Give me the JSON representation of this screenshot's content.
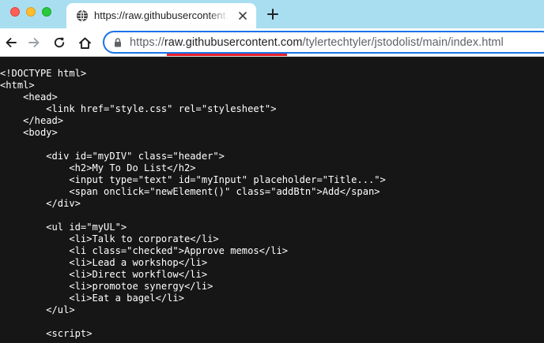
{
  "browser": {
    "tab_title": "https://raw.githubusercontent.com/tylertechtyler/jstodolist/main/index.html",
    "address_bar": {
      "scheme": "https://",
      "host": "raw.githubusercontent.com",
      "path": "/tylertechtyler/jstodolist/main/index.html"
    }
  },
  "document": {
    "lines": [
      "<!DOCTYPE html>",
      "<html>",
      "    <head>",
      "        <link href=\"style.css\" rel=\"stylesheet\">",
      "    </head>",
      "    <body>",
      "",
      "        <div id=\"myDIV\" class=\"header\">",
      "            <h2>My To Do List</h2>",
      "            <input type=\"text\" id=\"myInput\" placeholder=\"Title...\">",
      "            <span onclick=\"newElement()\" class=\"addBtn\">Add</span>",
      "        </div>",
      "",
      "        <ul id=\"myUL\">",
      "            <li>Talk to corporate</li>",
      "            <li class=\"checked\">Approve memos</li>",
      "            <li>Lead a workshop</li>",
      "            <li>Direct workflow</li>",
      "            <li>promotoe synergy</li>",
      "            <li>Eat a bagel</li>",
      "        </ul>",
      "",
      "        <script>"
    ]
  },
  "colors": {
    "tabbar_bg": "#a9def0",
    "omnibox_focus": "#1a73e8",
    "annotation_underline": "#e8202a",
    "page_bg": "#161616"
  },
  "icons": [
    "globe-icon",
    "close-icon",
    "plus-icon",
    "back-arrow-icon",
    "forward-arrow-icon",
    "reload-icon",
    "home-icon",
    "lock-icon"
  ]
}
